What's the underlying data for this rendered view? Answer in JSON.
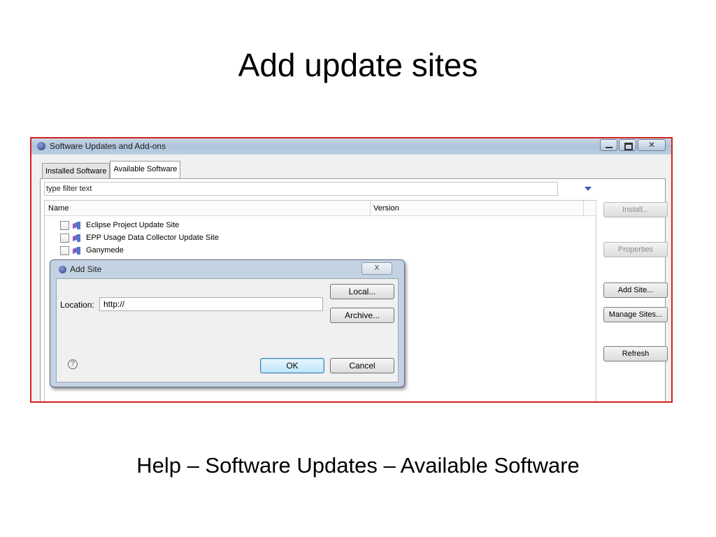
{
  "slide": {
    "title": "Add update sites",
    "caption": "Help – Software Updates – Available Software"
  },
  "window": {
    "title": "Software Updates and Add-ons",
    "tabs": [
      "Installed Software",
      "Available Software"
    ],
    "active_tab": "Available Software",
    "filter_placeholder": "type filter text",
    "columns": {
      "name": "Name",
      "version": "Version"
    },
    "sites": [
      {
        "label": "Eclipse Project Update Site",
        "checked": false
      },
      {
        "label": "EPP Usage Data Collector Update Site",
        "checked": false
      },
      {
        "label": "Ganymede",
        "checked": false
      }
    ],
    "side_buttons": {
      "install": "Install...",
      "properties": "Properties",
      "add_site": "Add Site...",
      "manage_sites": "Manage Sites...",
      "refresh": "Refresh"
    },
    "border_color": "#d42020"
  },
  "dialog": {
    "title": "Add Site",
    "close_glyph": "X",
    "location_label": "Location:",
    "location_value": "http://",
    "buttons": {
      "local": "Local...",
      "archive": "Archive...",
      "ok": "OK",
      "cancel": "Cancel"
    },
    "help_glyph": "?"
  }
}
